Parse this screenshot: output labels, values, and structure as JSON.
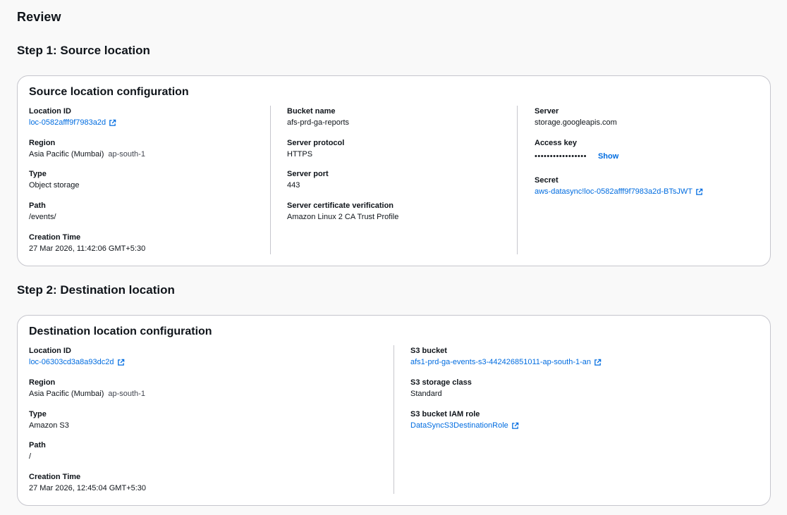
{
  "page_title": "Review",
  "step1": {
    "title": "Step 1: Source location",
    "card_title": "Source location configuration",
    "location_id": {
      "label": "Location ID",
      "value": "loc-0582afff9f7983a2d"
    },
    "region": {
      "label": "Region",
      "value": "Asia Pacific (Mumbai)",
      "code": "ap-south-1"
    },
    "type": {
      "label": "Type",
      "value": "Object storage"
    },
    "path": {
      "label": "Path",
      "value": "/events/"
    },
    "creation_time": {
      "label": "Creation Time",
      "value": "27 Mar 2026, 11:42:06 GMT+5:30"
    },
    "bucket_name": {
      "label": "Bucket name",
      "value": "afs-prd-ga-reports"
    },
    "server_protocol": {
      "label": "Server protocol",
      "value": "HTTPS"
    },
    "server_port": {
      "label": "Server port",
      "value": "443"
    },
    "cert_verification": {
      "label": "Server certificate verification",
      "value": "Amazon Linux 2 CA Trust Profile"
    },
    "server": {
      "label": "Server",
      "value": "storage.googleapis.com"
    },
    "access_key": {
      "label": "Access key",
      "value": "•••••••••••••••••",
      "show_label": "Show"
    },
    "secret": {
      "label": "Secret",
      "value": "aws-datasync!loc-0582afff9f7983a2d-BTsJWT"
    }
  },
  "step2": {
    "title": "Step 2: Destination location",
    "card_title": "Destination location configuration",
    "location_id": {
      "label": "Location ID",
      "value": "loc-06303cd3a8a93dc2d"
    },
    "region": {
      "label": "Region",
      "value": "Asia Pacific (Mumbai)",
      "code": "ap-south-1"
    },
    "type": {
      "label": "Type",
      "value": "Amazon S3"
    },
    "path": {
      "label": "Path",
      "value": "/"
    },
    "creation_time": {
      "label": "Creation Time",
      "value": "27 Mar 2026, 12:45:04 GMT+5:30"
    },
    "s3_bucket": {
      "label": "S3 bucket",
      "value": "afs1-prd-ga-events-s3-442426851011-ap-south-1-an"
    },
    "storage_class": {
      "label": "S3 storage class",
      "value": "Standard"
    },
    "iam_role": {
      "label": "S3 bucket IAM role",
      "value": "DataSyncS3DestinationRole"
    }
  },
  "colors": {
    "link": "#006ce0",
    "border": "#c6c6cd",
    "background": "#f9f9f9"
  },
  "icons": {
    "external_link": "external-link-icon"
  }
}
